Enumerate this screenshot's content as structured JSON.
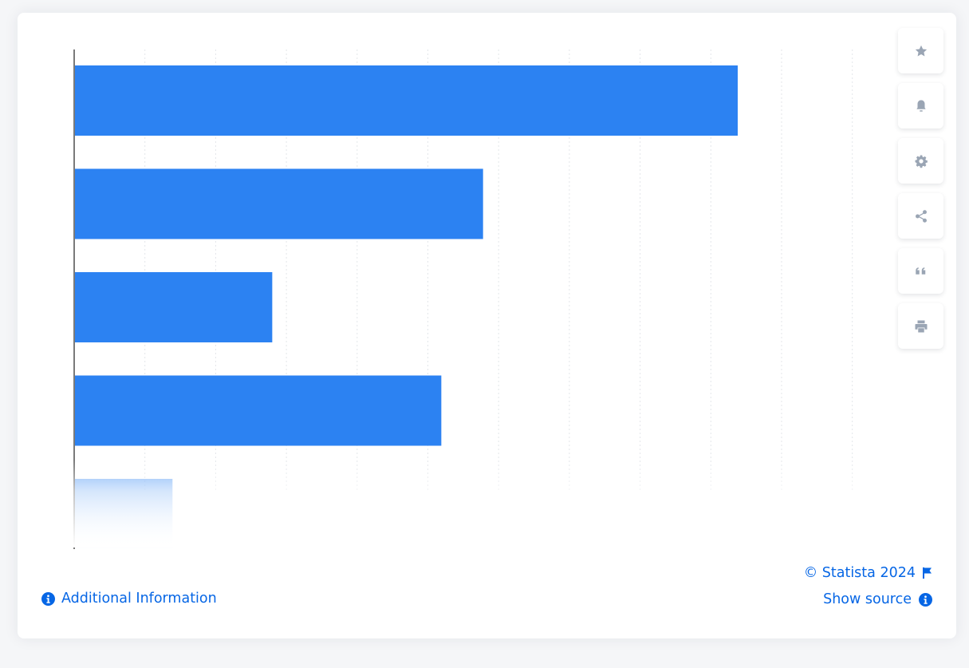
{
  "colors": {
    "bar": "#2c82f2",
    "link": "#0666e5",
    "icon": "#9aa5b4",
    "grid": "#e3e6ea",
    "axis": "#7a7a7a"
  },
  "toolbar": {
    "items": [
      {
        "name": "favorite",
        "icon": "star-icon"
      },
      {
        "name": "notifications",
        "icon": "bell-icon"
      },
      {
        "name": "settings",
        "icon": "gear-icon"
      },
      {
        "name": "share",
        "icon": "share-icon"
      },
      {
        "name": "cite",
        "icon": "quote-icon"
      },
      {
        "name": "print",
        "icon": "printer-icon"
      }
    ]
  },
  "footer": {
    "additional_info": "Additional Information",
    "copyright": "© Statista 2024",
    "show_source": "Show source"
  },
  "chart_data": {
    "type": "bar",
    "orientation": "horizontal",
    "title": "",
    "xlabel": "",
    "ylabel": "",
    "categories": [
      "",
      "",
      "",
      "",
      ""
    ],
    "values": [
      9.38,
      5.78,
      2.8,
      5.19,
      1.39
    ],
    "value_units": "gridline intervals (axis tick labels not visible)",
    "xlim": [
      0,
      11
    ],
    "grid": true,
    "legend": "none",
    "last_bar_faded": true
  }
}
